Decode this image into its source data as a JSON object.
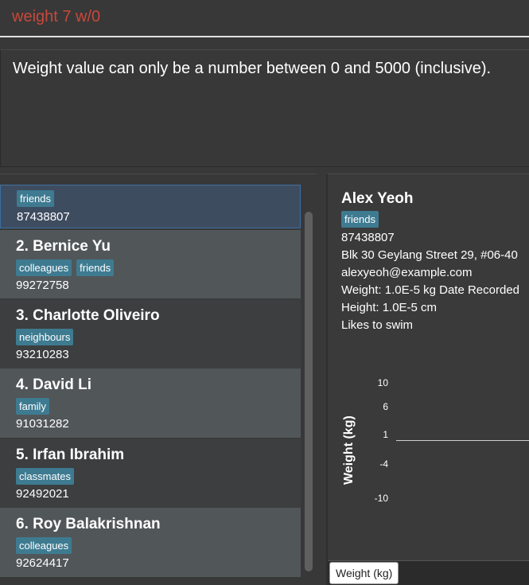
{
  "command": {
    "text": "weight 7 w/0"
  },
  "result": {
    "text": "Weight value can only be a number between 0 and 5000 (inclusive)."
  },
  "persons": [
    {
      "name": "",
      "tags": [
        "friends"
      ],
      "phone": "87438807"
    },
    {
      "name": "2. Bernice Yu",
      "tags": [
        "colleagues",
        "friends"
      ],
      "phone": "99272758"
    },
    {
      "name": "3. Charlotte Oliveiro",
      "tags": [
        "neighbours"
      ],
      "phone": "93210283"
    },
    {
      "name": "4. David Li",
      "tags": [
        "family"
      ],
      "phone": "91031282"
    },
    {
      "name": "5. Irfan Ibrahim",
      "tags": [
        "classmates"
      ],
      "phone": "92492021"
    },
    {
      "name": "6. Roy Balakrishnan",
      "tags": [
        "colleagues"
      ],
      "phone": "92624417"
    }
  ],
  "detail": {
    "name": "Alex Yeoh",
    "tag": "friends",
    "phone": "87438807",
    "address": "Blk 30 Geylang Street 29, #06-40",
    "email": "alexyeoh@example.com",
    "weight_line": "Weight: 1.0E-5 kg   Date Recorded",
    "height_line": "Height: 1.0E-5 cm",
    "remark": "Likes to swim"
  },
  "chart": {
    "y_axis_label": "Weight (kg)",
    "ticks": [
      "10",
      "6",
      "1",
      "-4",
      "-10"
    ],
    "legend": "Weight (kg)"
  },
  "colors": {
    "command_text": "#c8483b",
    "tag": "#3e7b91",
    "selected": "#3e4c60"
  }
}
